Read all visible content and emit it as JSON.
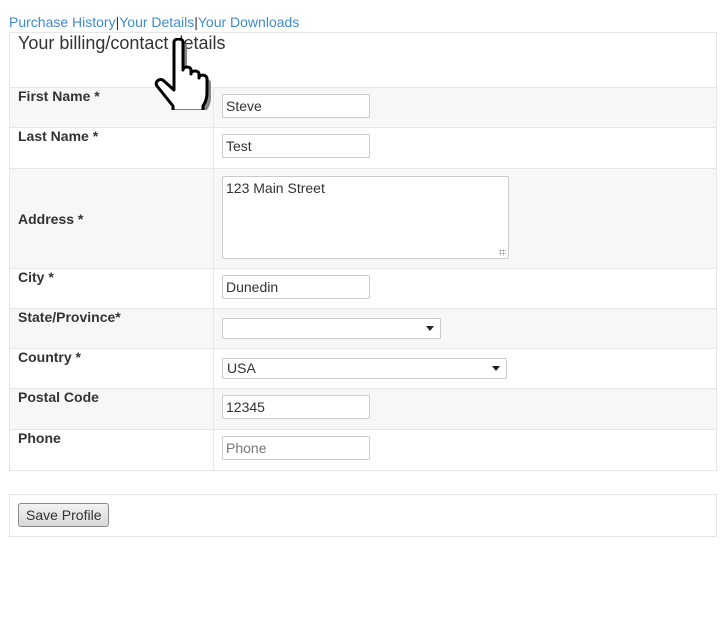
{
  "nav": {
    "links": [
      "Purchase History",
      "Your Details",
      "Your Downloads"
    ],
    "separator": "|"
  },
  "form": {
    "title": "Your billing/contact details",
    "fields": {
      "first_name": {
        "label": "First Name *",
        "value": "Steve"
      },
      "last_name": {
        "label": "Last Name *",
        "value": "Test"
      },
      "address": {
        "label": "Address *",
        "value": "123 Main Street"
      },
      "city": {
        "label": "City *",
        "value": "Dunedin"
      },
      "state": {
        "label": "State/Province*",
        "value": ""
      },
      "country": {
        "label": "Country *",
        "value": "USA"
      },
      "postal_code": {
        "label": "Postal Code",
        "value": "12345"
      },
      "phone": {
        "label": "Phone",
        "value": "",
        "placeholder": "Phone"
      }
    },
    "save_label": "Save Profile"
  },
  "cursor": {
    "type": "hand-pointer-icon"
  }
}
